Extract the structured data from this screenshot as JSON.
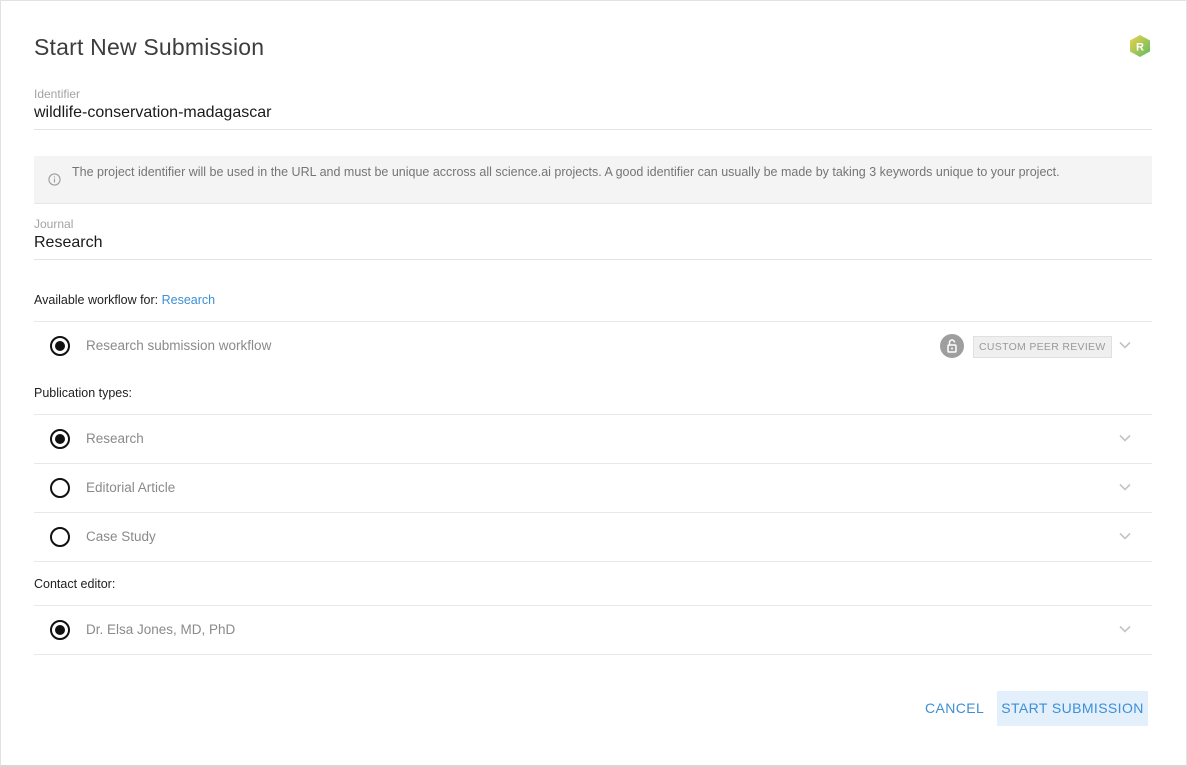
{
  "dialog": {
    "title": "Start New Submission",
    "avatar_letter": "R"
  },
  "identifier": {
    "label": "Identifier",
    "value": "wildlife-conservation-madagascar",
    "info": "The project identifier will be used in the URL and must be unique accross all science.ai projects. A good identifier can usually be made by taking 3 keywords unique to your project."
  },
  "journal": {
    "label": "Journal",
    "value": "Research"
  },
  "workflow": {
    "heading_prefix": "Available workflow for:",
    "heading_link": "Research",
    "items": [
      {
        "label": "Research submission workflow",
        "selected": true,
        "tag": "CUSTOM PEER REVIEW"
      }
    ]
  },
  "publication_types": {
    "heading": "Publication types:",
    "items": [
      {
        "label": "Research",
        "selected": true
      },
      {
        "label": "Editorial Article",
        "selected": false
      },
      {
        "label": "Case Study",
        "selected": false
      }
    ]
  },
  "contact_editor": {
    "heading": "Contact editor:",
    "items": [
      {
        "label": "Dr. Elsa Jones, MD, PhD",
        "selected": true
      }
    ]
  },
  "actions": {
    "cancel_label": "CANCEL",
    "start_label": "START SUBMISSION"
  },
  "colors": {
    "accent": "#3d8fd6",
    "avatar_green": "#8cc63f"
  }
}
